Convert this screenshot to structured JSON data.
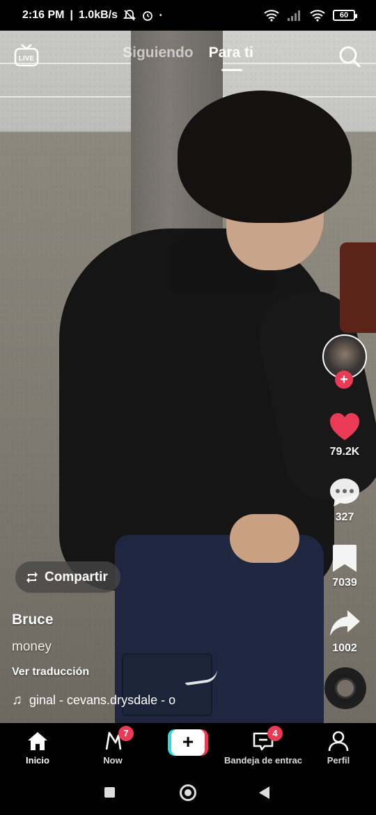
{
  "status_bar": {
    "time": "2:16 PM",
    "speed": "1.0kB/s",
    "battery": "60",
    "icons": [
      "mute-icon",
      "alarm-icon",
      "wifi-icon",
      "signal-icon",
      "wifi-icon",
      "battery-icon"
    ]
  },
  "top_nav": {
    "live_label": "LIVE",
    "tab_following": "Siguiendo",
    "tab_for_you": "Para ti",
    "active_tab": "Para ti"
  },
  "rail": {
    "likes": "79.2K",
    "comments": "327",
    "saves": "7039",
    "shares": "1002",
    "like_color": "#ea3a56"
  },
  "post": {
    "share_label": "Compartir",
    "username": "Bruce",
    "caption": "money",
    "translate_label": "Ver traducción",
    "music": "ginal - cevans.drysdale - o"
  },
  "bottom_nav": {
    "home": "Inicio",
    "now": "Now",
    "now_badge": "7",
    "inbox": "Bandeja de entrac",
    "inbox_badge": "4",
    "profile": "Perfil",
    "active": "Inicio"
  },
  "colors": {
    "accent_red": "#ea3a56",
    "accent_cyan": "#3ad6e0"
  }
}
